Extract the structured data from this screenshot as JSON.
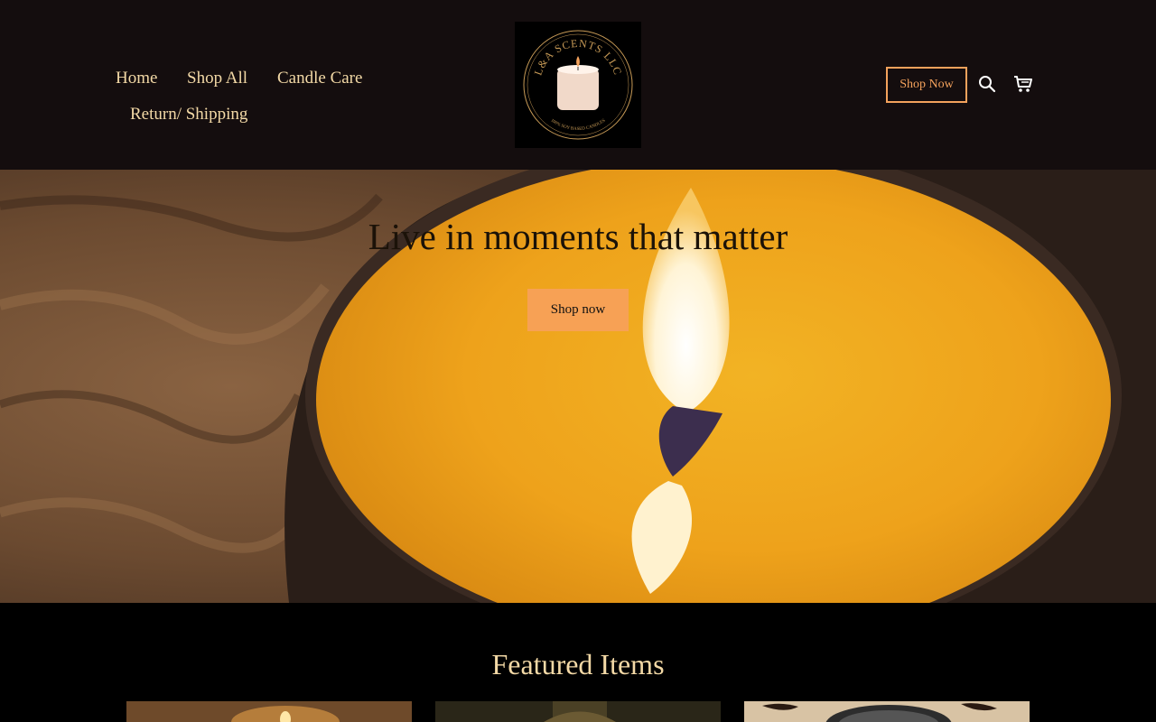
{
  "nav": {
    "items": [
      "Home",
      "Shop All",
      "Candle Care",
      "Return/ Shipping"
    ]
  },
  "logo": {
    "brand": "L&A SCENTS LLC",
    "ring_text": "100% SOY BASED CANDLES"
  },
  "header": {
    "shop_now_label": "Shop Now",
    "search_icon": "search-icon",
    "cart_icon": "cart-icon"
  },
  "hero": {
    "title": "Live in moments that matter",
    "button_label": "Shop now"
  },
  "featured": {
    "title": "Featured Items"
  },
  "colors": {
    "header_bg": "#140d0e",
    "nav_text": "#f3d9a6",
    "accent": "#f4a25c",
    "hero_button": "#f7a155"
  }
}
